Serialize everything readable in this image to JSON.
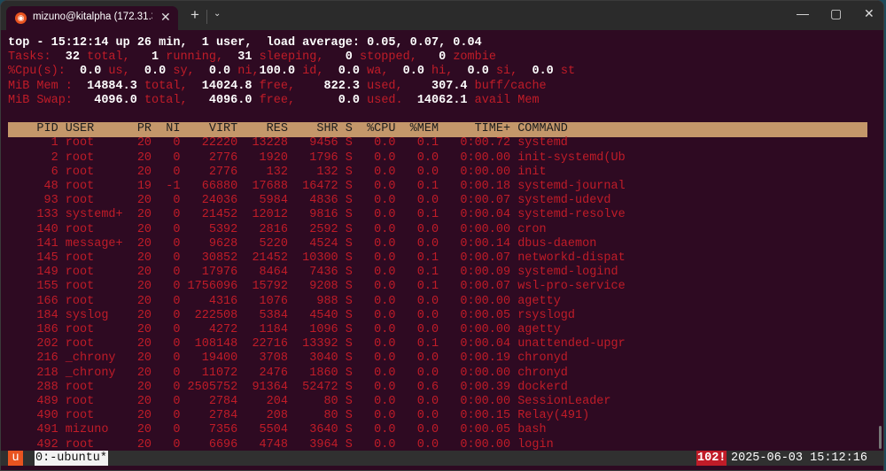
{
  "window": {
    "tab_title": "mizuno@kitalpha (172.31.37.42)",
    "tab_icon": "ubuntu-logo-icon",
    "new_tab": "+",
    "dropdown": "⌄",
    "minimize": "—",
    "maximize": "▢",
    "close": "✕"
  },
  "colors": {
    "background": "#2e0a22",
    "red": "#c01c28",
    "header_bar": "#c4976a",
    "accent": "#e95420"
  },
  "summary": [
    [
      {
        "t": "top - 15:12:14 up 26 min,  1 user,  load average: 0.05, 0.07, 0.04",
        "c": "w"
      }
    ],
    [
      {
        "t": "Tasks:",
        "c": "r"
      },
      {
        "t": "  32",
        "c": "w"
      },
      {
        "t": " total,",
        "c": "r"
      },
      {
        "t": "   1",
        "c": "w"
      },
      {
        "t": " running,",
        "c": "r"
      },
      {
        "t": "  31",
        "c": "w"
      },
      {
        "t": " sleeping,",
        "c": "r"
      },
      {
        "t": "   0",
        "c": "w"
      },
      {
        "t": " stopped,",
        "c": "r"
      },
      {
        "t": "   0",
        "c": "w"
      },
      {
        "t": " zombie",
        "c": "r"
      }
    ],
    [
      {
        "t": "%Cpu(s):",
        "c": "r"
      },
      {
        "t": "  0.0",
        "c": "w"
      },
      {
        "t": " us,",
        "c": "r"
      },
      {
        "t": "  0.0",
        "c": "w"
      },
      {
        "t": " sy,",
        "c": "r"
      },
      {
        "t": "  0.0",
        "c": "w"
      },
      {
        "t": " ni,",
        "c": "r"
      },
      {
        "t": "100.0",
        "c": "w"
      },
      {
        "t": " id,",
        "c": "r"
      },
      {
        "t": "  0.0",
        "c": "w"
      },
      {
        "t": " wa,",
        "c": "r"
      },
      {
        "t": "  0.0",
        "c": "w"
      },
      {
        "t": " hi,",
        "c": "r"
      },
      {
        "t": "  0.0",
        "c": "w"
      },
      {
        "t": " si,",
        "c": "r"
      },
      {
        "t": "  0.0",
        "c": "w"
      },
      {
        "t": " st",
        "c": "r"
      }
    ],
    [
      {
        "t": "MiB Mem :",
        "c": "r"
      },
      {
        "t": "  14884.3",
        "c": "w"
      },
      {
        "t": " total,",
        "c": "r"
      },
      {
        "t": "  14024.8",
        "c": "w"
      },
      {
        "t": " free,",
        "c": "r"
      },
      {
        "t": "    822.3",
        "c": "w"
      },
      {
        "t": " used,",
        "c": "r"
      },
      {
        "t": "    307.4",
        "c": "w"
      },
      {
        "t": " buff/cache",
        "c": "r"
      }
    ],
    [
      {
        "t": "MiB Swap:",
        "c": "r"
      },
      {
        "t": "   4096.0",
        "c": "w"
      },
      {
        "t": " total,",
        "c": "r"
      },
      {
        "t": "   4096.0",
        "c": "w"
      },
      {
        "t": " free,",
        "c": "r"
      },
      {
        "t": "      0.0",
        "c": "w"
      },
      {
        "t": " used.",
        "c": "r"
      },
      {
        "t": "  14062.1",
        "c": "w"
      },
      {
        "t": " avail Mem",
        "c": "r"
      }
    ]
  ],
  "table": {
    "columns": [
      "PID",
      "USER",
      "PR",
      "NI",
      "VIRT",
      "RES",
      "SHR",
      "S",
      "%CPU",
      "%MEM",
      "TIME+",
      "COMMAND"
    ],
    "rows": [
      [
        "1",
        "root",
        "20",
        "0",
        "22220",
        "13228",
        "9456",
        "S",
        "0.0",
        "0.1",
        "0:00.72",
        "systemd"
      ],
      [
        "2",
        "root",
        "20",
        "0",
        "2776",
        "1920",
        "1796",
        "S",
        "0.0",
        "0.0",
        "0:00.00",
        "init-systemd(Ub"
      ],
      [
        "6",
        "root",
        "20",
        "0",
        "2776",
        "132",
        "132",
        "S",
        "0.0",
        "0.0",
        "0:00.00",
        "init"
      ],
      [
        "48",
        "root",
        "19",
        "-1",
        "66880",
        "17688",
        "16472",
        "S",
        "0.0",
        "0.1",
        "0:00.18",
        "systemd-journal"
      ],
      [
        "93",
        "root",
        "20",
        "0",
        "24036",
        "5984",
        "4836",
        "S",
        "0.0",
        "0.0",
        "0:00.07",
        "systemd-udevd"
      ],
      [
        "133",
        "systemd+",
        "20",
        "0",
        "21452",
        "12012",
        "9816",
        "S",
        "0.0",
        "0.1",
        "0:00.04",
        "systemd-resolve"
      ],
      [
        "140",
        "root",
        "20",
        "0",
        "5392",
        "2816",
        "2592",
        "S",
        "0.0",
        "0.0",
        "0:00.00",
        "cron"
      ],
      [
        "141",
        "message+",
        "20",
        "0",
        "9628",
        "5220",
        "4524",
        "S",
        "0.0",
        "0.0",
        "0:00.14",
        "dbus-daemon"
      ],
      [
        "145",
        "root",
        "20",
        "0",
        "30852",
        "21452",
        "10300",
        "S",
        "0.0",
        "0.1",
        "0:00.07",
        "networkd-dispat"
      ],
      [
        "149",
        "root",
        "20",
        "0",
        "17976",
        "8464",
        "7436",
        "S",
        "0.0",
        "0.1",
        "0:00.09",
        "systemd-logind"
      ],
      [
        "155",
        "root",
        "20",
        "0",
        "1756096",
        "15792",
        "9208",
        "S",
        "0.0",
        "0.1",
        "0:00.07",
        "wsl-pro-service"
      ],
      [
        "166",
        "root",
        "20",
        "0",
        "4316",
        "1076",
        "988",
        "S",
        "0.0",
        "0.0",
        "0:00.00",
        "agetty"
      ],
      [
        "184",
        "syslog",
        "20",
        "0",
        "222508",
        "5384",
        "4540",
        "S",
        "0.0",
        "0.0",
        "0:00.05",
        "rsyslogd"
      ],
      [
        "186",
        "root",
        "20",
        "0",
        "4272",
        "1184",
        "1096",
        "S",
        "0.0",
        "0.0",
        "0:00.00",
        "agetty"
      ],
      [
        "202",
        "root",
        "20",
        "0",
        "108148",
        "22716",
        "13392",
        "S",
        "0.0",
        "0.1",
        "0:00.04",
        "unattended-upgr"
      ],
      [
        "216",
        "_chrony",
        "20",
        "0",
        "19400",
        "3708",
        "3040",
        "S",
        "0.0",
        "0.0",
        "0:00.19",
        "chronyd"
      ],
      [
        "218",
        "_chrony",
        "20",
        "0",
        "11072",
        "2476",
        "1860",
        "S",
        "0.0",
        "0.0",
        "0:00.00",
        "chronyd"
      ],
      [
        "288",
        "root",
        "20",
        "0",
        "2505752",
        "91364",
        "52472",
        "S",
        "0.0",
        "0.6",
        "0:00.39",
        "dockerd"
      ],
      [
        "489",
        "root",
        "20",
        "0",
        "2784",
        "204",
        "80",
        "S",
        "0.0",
        "0.0",
        "0:00.00",
        "SessionLeader"
      ],
      [
        "490",
        "root",
        "20",
        "0",
        "2784",
        "208",
        "80",
        "S",
        "0.0",
        "0.0",
        "0:00.15",
        "Relay(491)"
      ],
      [
        "491",
        "mizuno",
        "20",
        "0",
        "7356",
        "5504",
        "3640",
        "S",
        "0.0",
        "0.0",
        "0:00.05",
        "bash"
      ],
      [
        "492",
        "root",
        "20",
        "0",
        "6696",
        "4748",
        "3964",
        "S",
        "0.0",
        "0.0",
        "0:00.00",
        "login"
      ]
    ]
  },
  "statusbar": {
    "session": "u",
    "window": "0:-ubuntu*",
    "alert": "102!",
    "datetime": "2025-06-03 15:12:16"
  }
}
